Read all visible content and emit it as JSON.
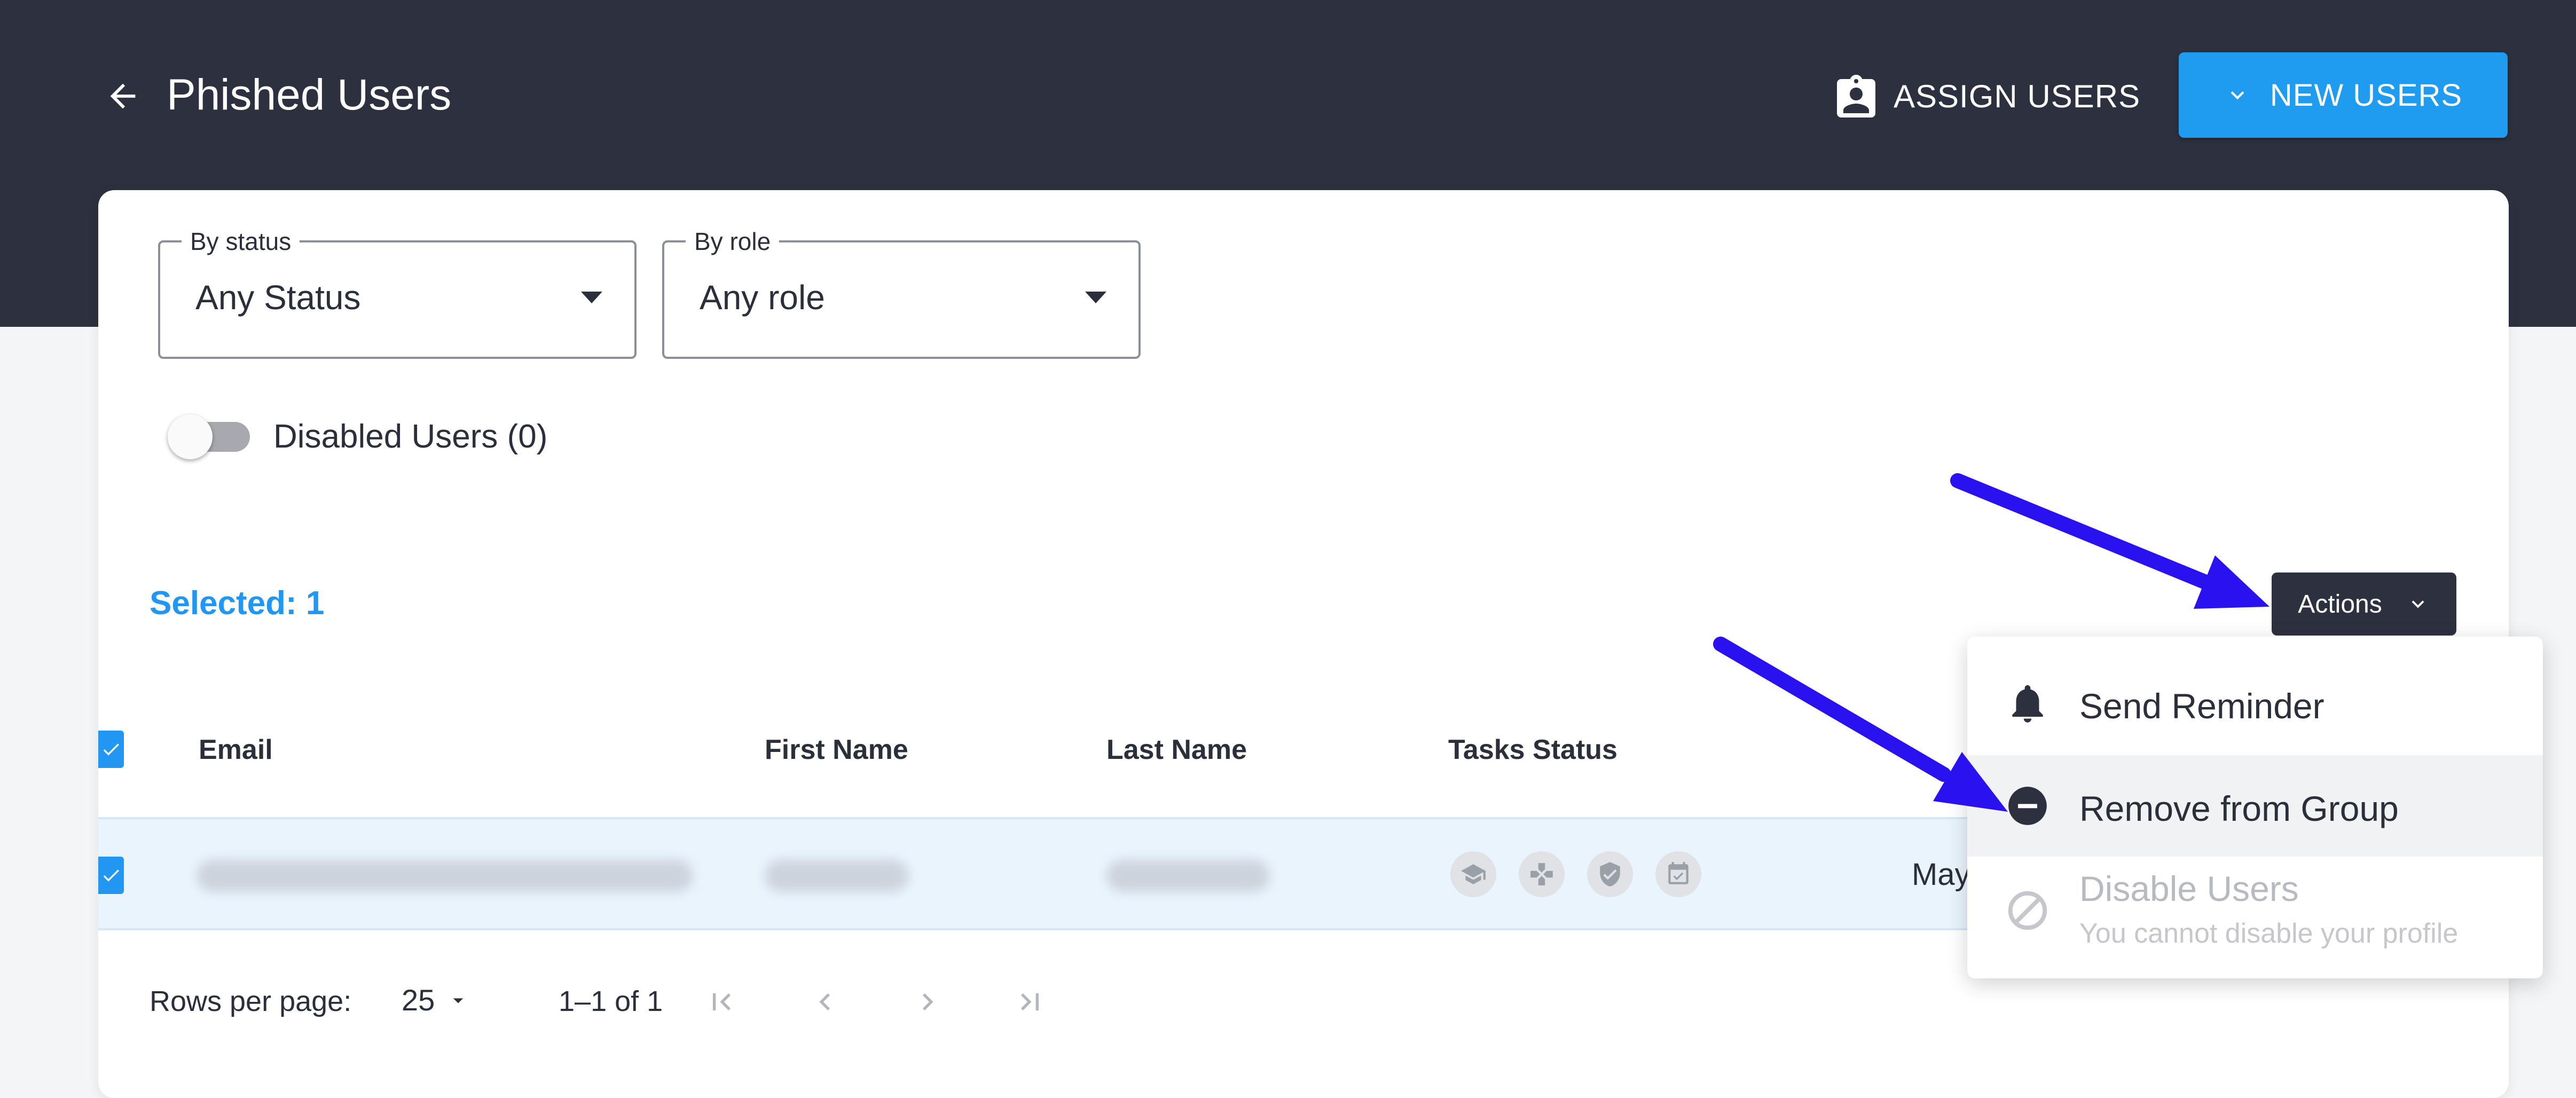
{
  "header": {
    "title": "Phished Users",
    "assign_users_label": "ASSIGN USERS",
    "new_users_label": "NEW USERS"
  },
  "filters": {
    "status": {
      "legend": "By status",
      "value": "Any Status"
    },
    "role": {
      "legend": "By role",
      "value": "Any role"
    },
    "disabled_users_label": "Disabled Users (0)",
    "disabled_users_on": false
  },
  "selection": {
    "label": "Selected: 1"
  },
  "actions": {
    "button_label": "Actions",
    "menu": [
      {
        "label": "Send Reminder",
        "icon": "bell-icon",
        "enabled": true
      },
      {
        "label": "Remove from Group",
        "icon": "minus-circle-icon",
        "enabled": true
      },
      {
        "label": "Disable Users",
        "sublabel": "You cannot disable your profile",
        "icon": "block-icon",
        "enabled": false
      }
    ]
  },
  "table": {
    "columns": [
      "Email",
      "First Name",
      "Last Name",
      "Tasks Status"
    ],
    "rows": [
      {
        "selected": true,
        "task_icons": [
          "graduation-cap-icon",
          "gamepad-icon",
          "shield-check-icon",
          "calendar-check-icon"
        ],
        "date_partial": "May"
      }
    ]
  },
  "pagination": {
    "rows_per_page_label": "Rows per page:",
    "rows_per_page_value": "25",
    "range": "1–1 of 1"
  },
  "colors": {
    "topbar": "#2d313f",
    "primary": "#1f9cf0",
    "selected_text": "#2196f3",
    "row_highlight": "#eaf4fd",
    "annotation_arrow": "#2a12f0"
  }
}
